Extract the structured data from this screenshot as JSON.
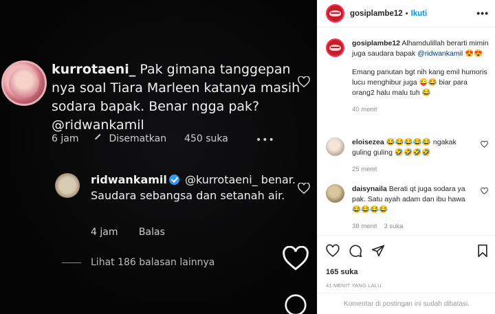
{
  "post_image": {
    "comment1": {
      "username": "kurrotaeni_",
      "text": "Pak gimana tanggepan nya soal Tiara Marleen katanya masih sodara bapak. Benar ngga pak? @ridwankamil",
      "time": "6 jam",
      "pinned": "Disematkan",
      "likes": "450 suka",
      "more": "•••"
    },
    "reply": {
      "username": "ridwankamil",
      "mention": "@kurrotaeni_",
      "text": "benar. Saudara sebangsa dan setanah air.",
      "time": "4 jam",
      "reply_label": "Balas"
    },
    "view_more": "Lihat 186 balasan lainnya"
  },
  "header": {
    "username": "gosiplambe12",
    "separator": "•",
    "follow_label": "Ikuti",
    "more": "•••"
  },
  "caption": {
    "username": "gosiplambe12",
    "text_line1": "Alhamdulillah berarti mimin juga saudara bapak",
    "mention": "@ridwankamil",
    "emoji1": "😍😍",
    "text_para2": "Emang panutan bgt nih kang emil humoris lucu menghibur juga 😜😂 biar para orang2 halu malu tuh 😂",
    "time": "40 menit"
  },
  "comments": [
    {
      "username": "eloisezea",
      "text": "😂😂😂😂😂 ngakak guling guling 🤣🤣🤣🤣",
      "time": "25 menit",
      "likes": ""
    },
    {
      "username": "daisynaila",
      "text": "Berati qt juga sodara ya pak. Satu ayah adam dan ibu hawa 😂😂😂😂",
      "time": "38 menit",
      "likes": "3 suka"
    }
  ],
  "actions": {
    "likes": "165 suka",
    "date": "41 MENIT YANG LALU",
    "comments_closed": "Komentar di postingan ini sudah dibatasi."
  },
  "colors": {
    "accent_blue": "#0095f6",
    "mention_blue": "#00376b",
    "muted": "#8e8e8e"
  }
}
